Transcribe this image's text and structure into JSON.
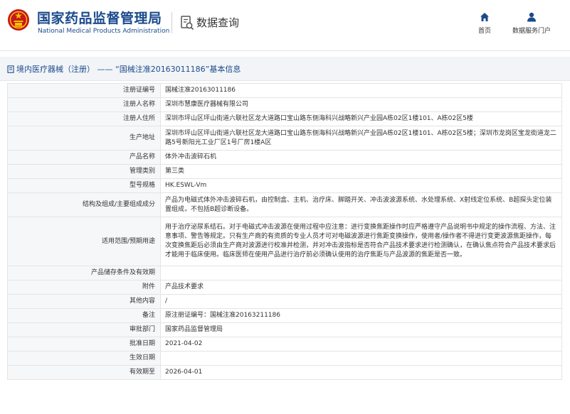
{
  "header": {
    "brand_cn": "国家药品监督管理局",
    "brand_en": "National Medical Products Administration",
    "query_title": "数据查询",
    "nav": [
      {
        "label": "首页",
        "icon": "home-icon"
      },
      {
        "label": "数据服务门户",
        "icon": "user-icon"
      }
    ]
  },
  "colors": {
    "brand": "#1b4a8c",
    "label_bg": "#f6f7f9",
    "border": "#e4e4e4"
  },
  "breadcrumb": "境内医疗器械（注册） —— “国械注准20163011186”基本信息",
  "details": [
    {
      "label": "注册证编号",
      "value": "国械注准20163011186"
    },
    {
      "label": "注册人名称",
      "value": "深圳市慧康医疗器械有限公司"
    },
    {
      "label": "注册人住所",
      "value": "深圳市坪山区坪山街道六联社区龙大道路口宝山路东侧海科兴战略新兴产业园A栋02区1楼101、A栋02区5楼"
    },
    {
      "label": "生产地址",
      "value": "深圳市坪山区坪山街道六联社区龙大道路口宝山路东侧海科兴战略新兴产业园A栋02区1楼101、A栋02区5楼；深圳市龙岗区宝龙街道龙二路5号新阳光工业厂区1号厂房1楼A区"
    },
    {
      "label": "产品名称",
      "value": "体外冲击波碎石机"
    },
    {
      "label": "管理类别",
      "value": "第三类"
    },
    {
      "label": "型号规格",
      "value": "HK.ESWL-Vm"
    },
    {
      "label": "结构及组成/主要组成成分",
      "value": "产品为电磁式体外冲击波碎石机，由控制盒、主机、治疗床、脚踏开关、冲击波波源系统、水处理系统、X射线定位系统、B超探头定位装置组成，不包括B超诊断设备。"
    },
    {
      "label": "适用范围/预期用途",
      "value": "用于治疗泌尿系结石。对于电磁式冲击波源在使用过程中应注意：进行变换焦距操作时应严格遵守产品说明书中规定的操作流程、方法、注意事项、警告等规定。只有生产商的有资质的专业人员才可对电磁波源进行焦距变换操作，使用者/操作者不得进行变更波源焦距操作，每次变换焦距后必须由生产商对波源进行校准并检测，并对冲击波指标是否符合产品技术要求进行检测确认，在确认焦点符合产品技术要求后才能用于临床使用。临床医师在使用产品进行治疗前必须确认使用的治疗焦距与产品波源的焦距是否一致。"
    },
    {
      "label": "产品储存条件及有效期",
      "value": ""
    },
    {
      "label": "附件",
      "value": "产品技术要求"
    },
    {
      "label": "其他内容",
      "value": "/"
    },
    {
      "label": "备注",
      "value": "原注册证编号：国械注准20163211186"
    },
    {
      "label": "审批部门",
      "value": "国家药品监督管理局"
    },
    {
      "label": "批准日期",
      "value": "2021-04-02"
    },
    {
      "label": "生效日期",
      "value": ""
    },
    {
      "label": "有效期至",
      "value": "2026-04-01"
    }
  ]
}
